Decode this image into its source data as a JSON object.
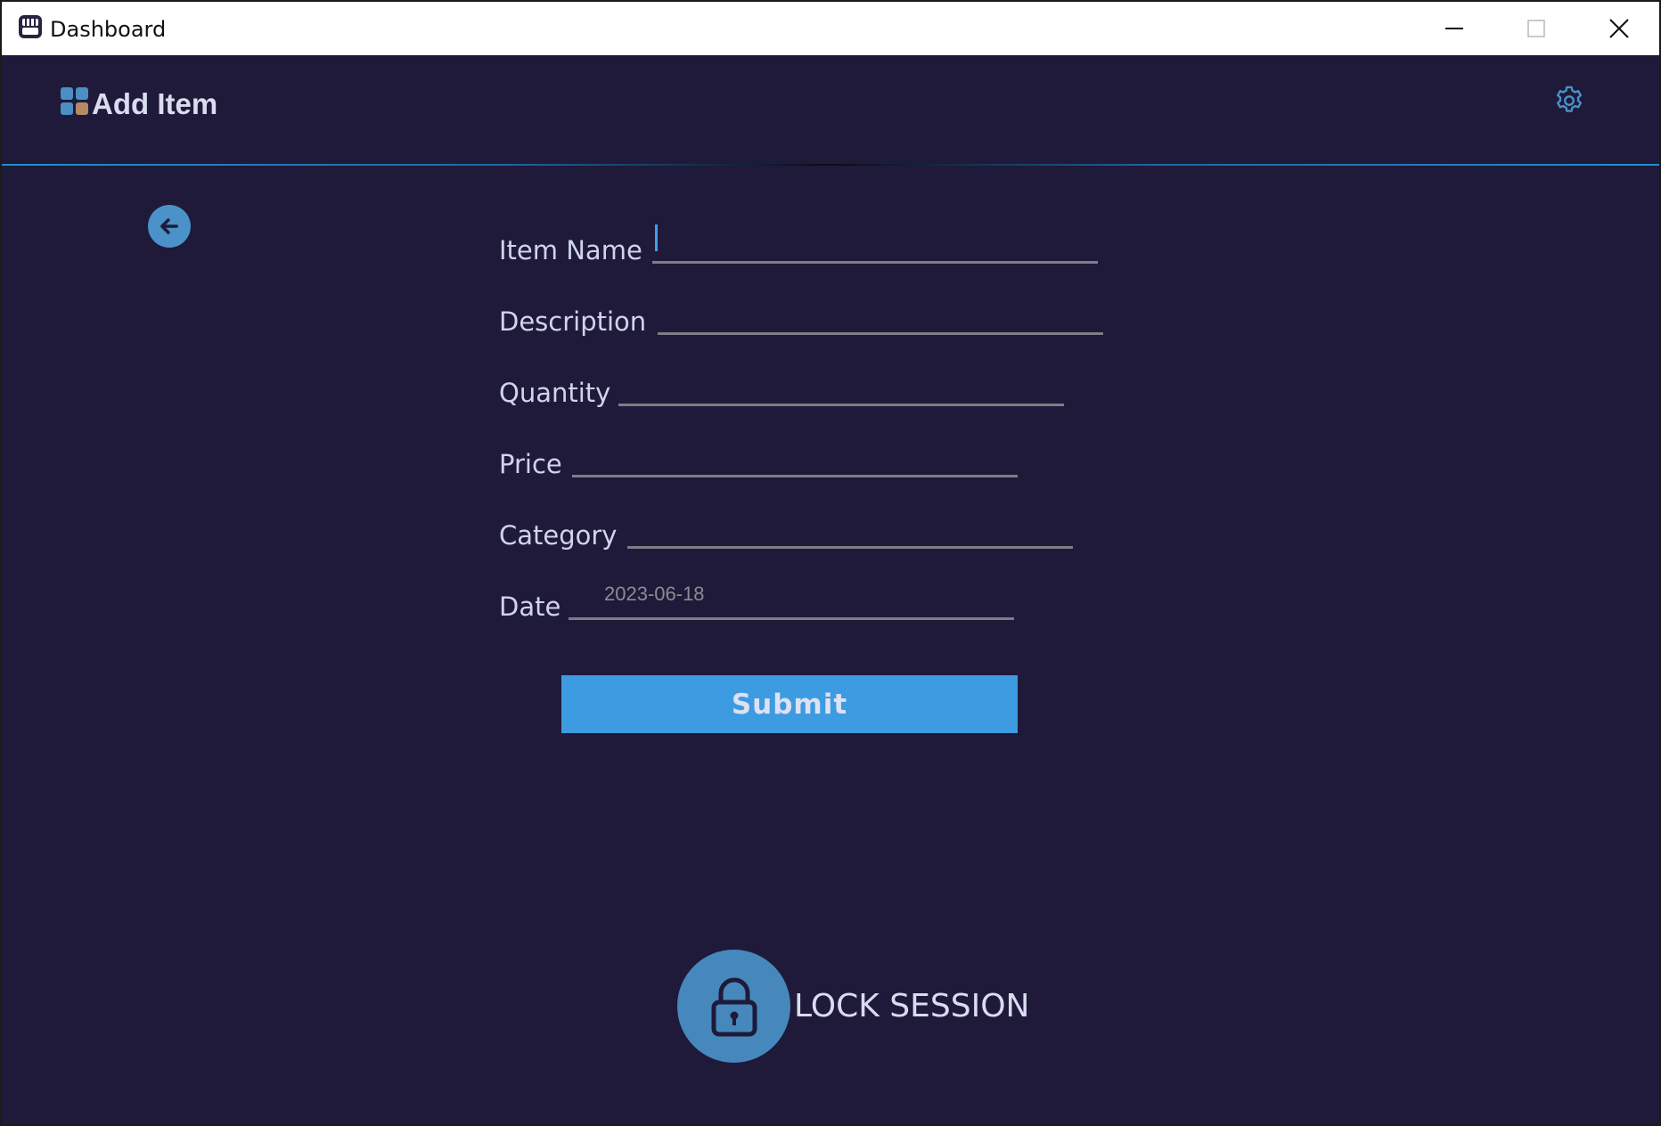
{
  "window": {
    "title": "Dashboard",
    "controls": {
      "minimize": "minimize",
      "maximize": "maximize",
      "close": "close"
    }
  },
  "header": {
    "title": "Add Item",
    "icons": {
      "app": "app-icon",
      "grid": "grid-icon",
      "settings": "gear-icon",
      "back": "arrow-left-icon",
      "lock": "lock-icon"
    }
  },
  "form": {
    "fields": [
      {
        "label": "Item Name",
        "value": ""
      },
      {
        "label": "Description",
        "value": ""
      },
      {
        "label": "Quantity",
        "value": ""
      },
      {
        "label": "Price",
        "value": ""
      },
      {
        "label": "Category",
        "value": ""
      },
      {
        "label": "Date",
        "value": "2023-06-18"
      }
    ],
    "submit_label": "Submit"
  },
  "footer": {
    "lock_label": "LOCK SESSION"
  },
  "colors": {
    "background": "#1f1a3a",
    "accent": "#3d9be2",
    "icon_blue": "#4a92c8",
    "text": "#d0d4ea"
  }
}
